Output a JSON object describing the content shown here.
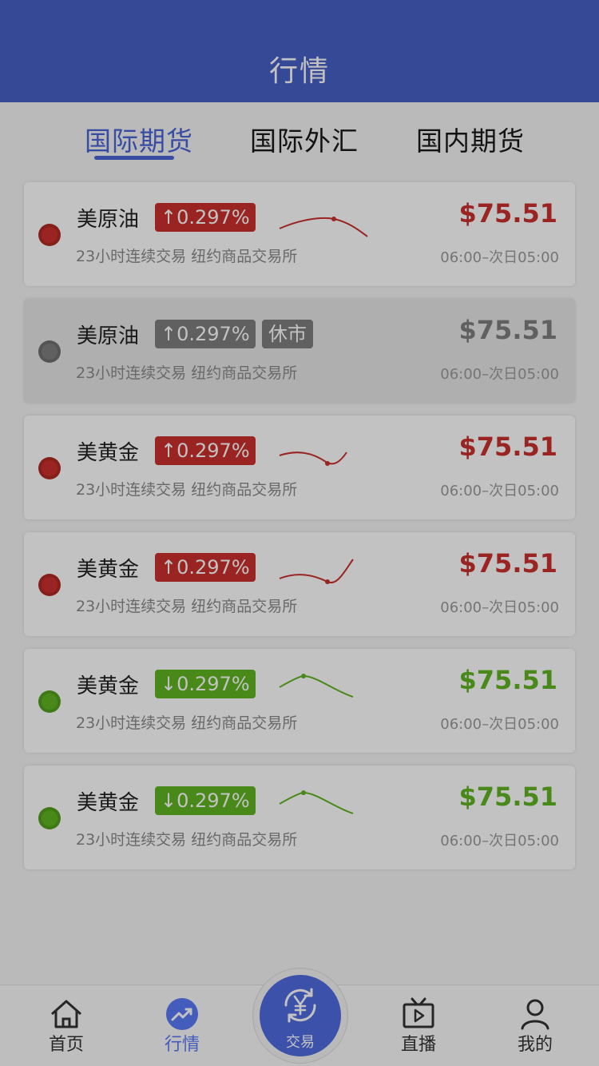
{
  "header": {
    "title": "行情"
  },
  "tabs": [
    {
      "label": "国际期货",
      "active": true
    },
    {
      "label": "国际外汇",
      "active": false
    },
    {
      "label": "国内期货",
      "active": false
    }
  ],
  "colors": {
    "up": "#c9302c",
    "down": "#5fb422",
    "closed": "#7f7f7f",
    "accent": "#4a65d6",
    "header": "#4760c7"
  },
  "quotes": [
    {
      "name": "美原油",
      "change": "↑0.297%",
      "direction": "up",
      "closed_label": "",
      "subtitle": "23小时连续交易  纽约商品交易所",
      "price": "$75.51",
      "hours": "06:00–次日05:00",
      "spark": "hump"
    },
    {
      "name": "美原油",
      "change": "↑0.297%",
      "direction": "closed",
      "closed_label": "休市",
      "subtitle": "23小时连续交易  纽约商品交易所",
      "price": "$75.51",
      "hours": "06:00–次日05:00",
      "spark": "none"
    },
    {
      "name": "美黄金",
      "change": "↑0.297%",
      "direction": "up",
      "closed_label": "",
      "subtitle": "23小时连续交易  纽约商品交易所",
      "price": "$75.51",
      "hours": "06:00–次日05:00",
      "spark": "dip-short"
    },
    {
      "name": "美黄金",
      "change": "↑0.297%",
      "direction": "up",
      "closed_label": "",
      "subtitle": "23小时连续交易  纽约商品交易所",
      "price": "$75.51",
      "hours": "06:00–次日05:00",
      "spark": "dip-long"
    },
    {
      "name": "美黄金",
      "change": "↓0.297%",
      "direction": "down",
      "closed_label": "",
      "subtitle": "23小时连续交易  纽约商品交易所",
      "price": "$75.51",
      "hours": "06:00–次日05:00",
      "spark": "bump"
    },
    {
      "name": "美黄金",
      "change": "↓0.297%",
      "direction": "down",
      "closed_label": "",
      "subtitle": "23小时连续交易  纽约商品交易所",
      "price": "$75.51",
      "hours": "06:00–次日05:00",
      "spark": "bump"
    }
  ],
  "bottom_nav": {
    "home": {
      "label": "首页",
      "icon": "home-icon"
    },
    "market": {
      "label": "行情",
      "icon": "trend-up-icon",
      "active": true
    },
    "trade": {
      "label": "交易",
      "icon": "yen-exchange-icon"
    },
    "live": {
      "label": "直播",
      "icon": "tv-play-icon"
    },
    "mine": {
      "label": "我的",
      "icon": "user-icon"
    }
  }
}
